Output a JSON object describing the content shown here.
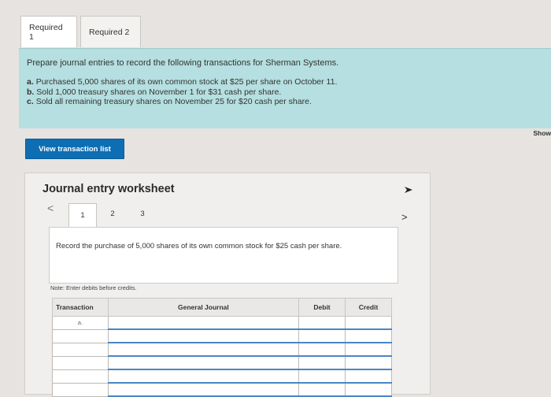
{
  "tabs": [
    {
      "label": "Required 1",
      "active": true
    },
    {
      "label": "Required 2",
      "active": false
    }
  ],
  "instructions": {
    "intro": "Prepare journal entries to record the following transactions for Sherman Systems.",
    "items": [
      {
        "letter": "a.",
        "text": "Purchased 5,000 shares of its own common stock at $25 per share on October 11."
      },
      {
        "letter": "b.",
        "text": "Sold 1,000 treasury shares on November 1 for $31 cash per share."
      },
      {
        "letter": "c.",
        "text": "Sold all remaining treasury shares on November 25 for $20 cash per share."
      }
    ]
  },
  "show_label_truncated": "Show",
  "view_button_label": "View transaction list",
  "worksheet": {
    "title": "Journal entry worksheet",
    "nav_prev": "<",
    "nav_next": ">",
    "steps": [
      "1",
      "2",
      "3"
    ],
    "active_step": "1",
    "prompt": "Record the purchase of 5,000 shares of its own common stock for $25 cash per share.",
    "note": "Note: Enter debits before credits.",
    "table": {
      "headers": {
        "transaction": "Transaction",
        "journal": "General Journal",
        "debit": "Debit",
        "credit": "Credit"
      },
      "rows": [
        {
          "transaction": "a.",
          "journal": "",
          "debit": "",
          "credit": ""
        },
        {
          "transaction": "",
          "journal": "",
          "debit": "",
          "credit": ""
        },
        {
          "transaction": "",
          "journal": "",
          "debit": "",
          "credit": ""
        },
        {
          "transaction": "",
          "journal": "",
          "debit": "",
          "credit": ""
        },
        {
          "transaction": "",
          "journal": "",
          "debit": "",
          "credit": ""
        },
        {
          "transaction": "",
          "journal": "",
          "debit": "",
          "credit": ""
        }
      ]
    }
  },
  "colors": {
    "accent_button": "#0e6eb3",
    "banner": "#b5dfe0",
    "entry_underline": "#4a86c5"
  }
}
